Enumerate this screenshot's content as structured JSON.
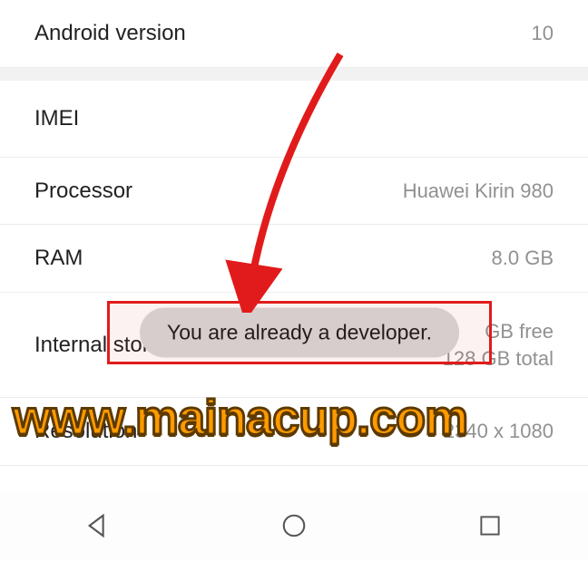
{
  "rows": {
    "android_version": {
      "label": "Android version",
      "value": "10"
    },
    "imei": {
      "label": "IMEI"
    },
    "processor": {
      "label": "Processor",
      "value": "Huawei Kirin 980"
    },
    "ram": {
      "label": "RAM",
      "value": "8.0 GB"
    },
    "storage": {
      "label": "Internal storage",
      "line1": "GB free",
      "line2": "128 GB total"
    },
    "resolution": {
      "label": "Resolution",
      "value": "2340 x 1080"
    }
  },
  "toast": {
    "message": "You are already a developer."
  },
  "watermark": "www.mainacup.com",
  "annotation": {
    "highlight_color": "#e11b1b"
  }
}
